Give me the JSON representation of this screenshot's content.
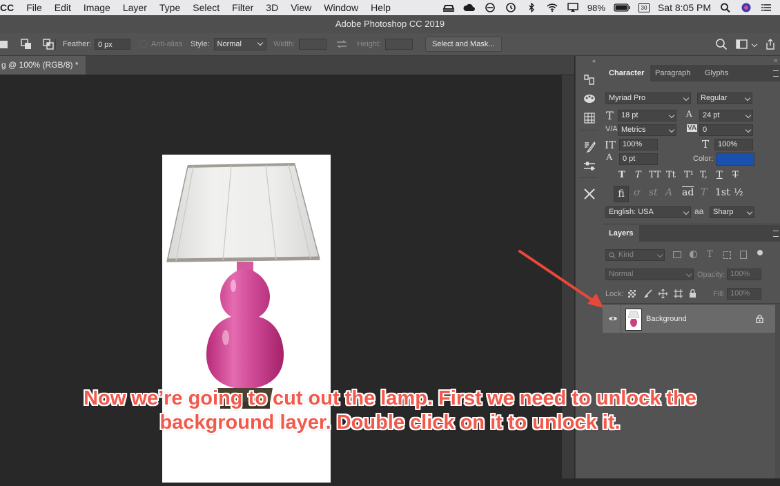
{
  "menubar": {
    "app_fragment": "CC",
    "items": [
      "File",
      "Edit",
      "Image",
      "Layer",
      "Type",
      "Select",
      "Filter",
      "3D",
      "View",
      "Window",
      "Help"
    ],
    "battery": "98%",
    "clock": "Sat 8:05 PM",
    "calendar_day": "30"
  },
  "window": {
    "title": "Adobe Photoshop CC 2019"
  },
  "options": {
    "feather_label": "Feather:",
    "feather_value": "0 px",
    "antialias_label": "Anti-alias",
    "style_label": "Style:",
    "style_value": "Normal",
    "width_label": "Width:",
    "height_label": "Height:",
    "select_mask": "Select and Mask..."
  },
  "document": {
    "tab_label": "g @ 100% (RGB/8) *"
  },
  "character": {
    "tabs": [
      "Character",
      "Paragraph",
      "Glyphs"
    ],
    "font_family": "Myriad Pro",
    "font_style": "Regular",
    "size": "18 pt",
    "leading": "24 pt",
    "kerning": "Metrics",
    "tracking": "0",
    "vscale": "100%",
    "hscale": "100%",
    "baseline": "0 pt",
    "color_label": "Color:",
    "color": "#1b4fb0",
    "language": "English: USA",
    "aa_icon": "aa",
    "antialias": "Sharp",
    "style_buttons": [
      "T",
      "T",
      "TT",
      "Tt",
      "T¹",
      "T,",
      "T",
      "T"
    ],
    "opentype_buttons": [
      "fi",
      "ơ",
      "st",
      "A",
      "ad",
      "T",
      "1st",
      "½"
    ]
  },
  "layers": {
    "tab": "Layers",
    "filter_kind": "Kind",
    "blend_mode": "Normal",
    "opacity_label": "Opacity:",
    "opacity_value": "100%",
    "lock_label": "Lock:",
    "fill_label": "Fill:",
    "fill_value": "100%",
    "items": [
      {
        "name": "Background",
        "locked": true,
        "visible": true
      }
    ]
  },
  "annotation": {
    "line1": "Now we’re going to cut out the lamp. First we need to unlock the",
    "line2": "background layer. Double click on it to unlock it.",
    "arrow_color": "#e8483a"
  }
}
